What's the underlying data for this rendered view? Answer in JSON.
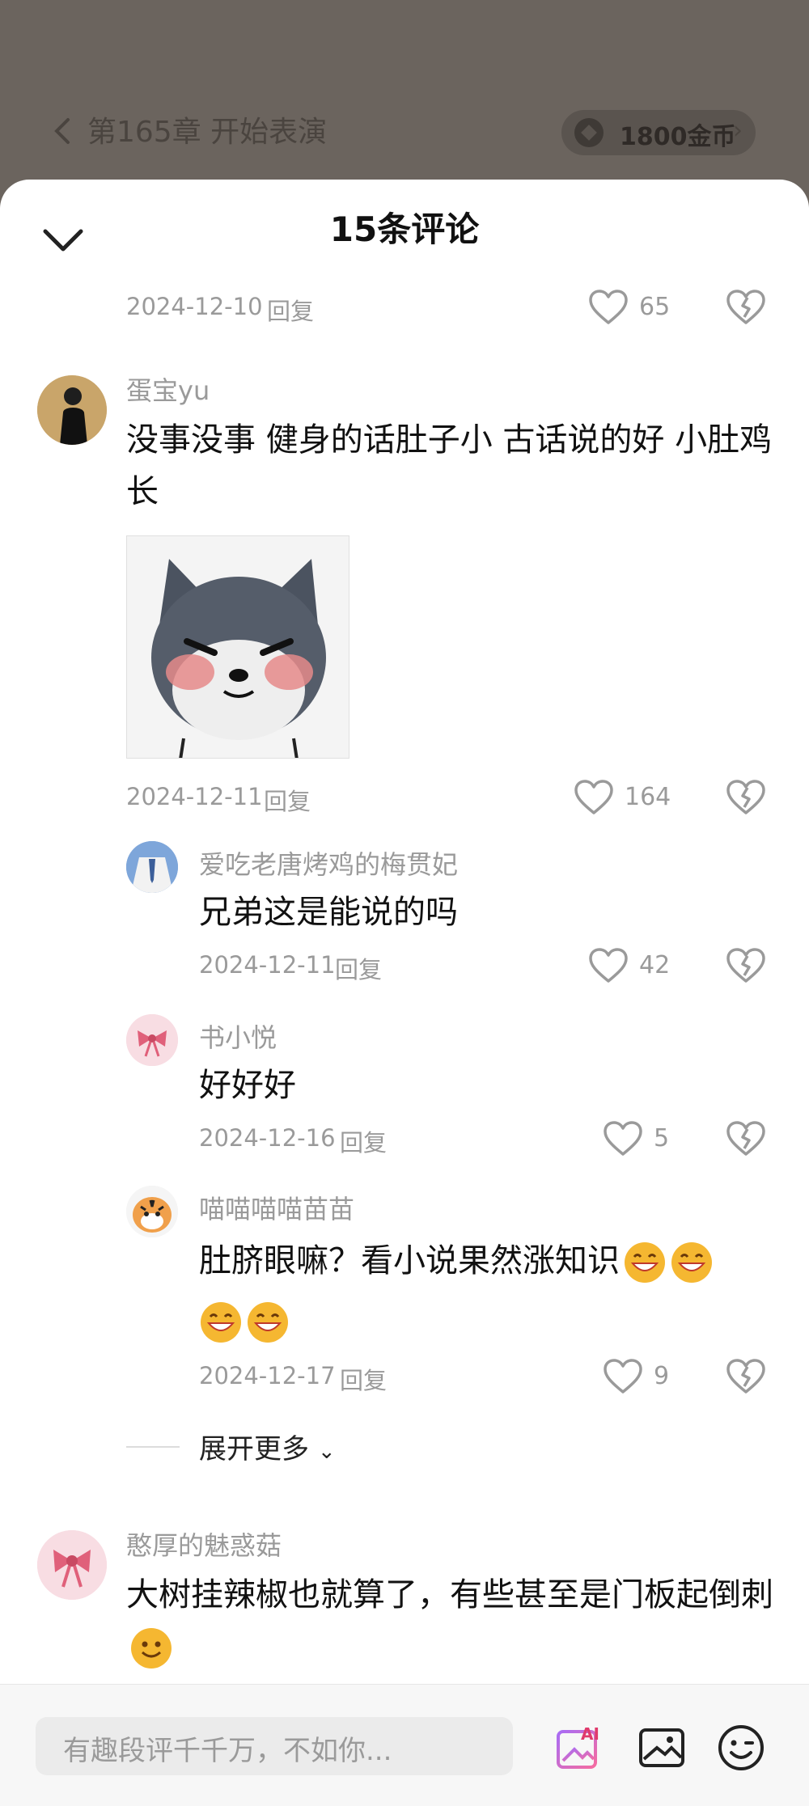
{
  "background": {
    "chapter_title": "第165章 开始表演",
    "coins_label": "1800金币"
  },
  "sheet": {
    "title": "15条评论",
    "top_item": {
      "date": "2024-12-10",
      "reply": "回复",
      "likes": "65"
    },
    "comments": [
      {
        "user": "蛋宝yu",
        "text": "没事没事 健身的话肚子小 古话说的好 小肚鸡长",
        "date": "2024-12-11",
        "reply": "回复",
        "likes": "164",
        "replies": [
          {
            "user": "爱吃老唐烤鸡的梅贯妃",
            "text": "兄弟这是能说的吗",
            "date": "2024-12-11",
            "reply": "回复",
            "likes": "42"
          },
          {
            "user": "书小悦",
            "text": "好好好",
            "date": "2024-12-16",
            "reply": "回复",
            "likes": "5"
          },
          {
            "user": "喵喵喵喵苗苗",
            "text": "肚脐眼嘛？看小说果然涨知识",
            "date": "2024-12-17",
            "reply": "回复",
            "likes": "9"
          }
        ],
        "expand_label": "展开更多"
      },
      {
        "user": "憨厚的魅惑菇",
        "text": "大树挂辣椒也就算了，有些甚至是门板起倒刺"
      }
    ]
  },
  "bottom_bar": {
    "input_placeholder": "有趣段评千千万，不如你...",
    "ai_label": "AI"
  },
  "icons": [
    "chevron-left-icon",
    "coin-icon",
    "chevron-right-icon",
    "chevron-down-icon",
    "heart-icon",
    "broken-heart-icon",
    "grin-emoji-icon",
    "smile-emoji-icon",
    "ai-icon",
    "image-icon",
    "emoji-icon"
  ],
  "colors": {
    "overlay": "#6b645e",
    "text": "#111111",
    "muted": "#9a9a9a",
    "emoji": "#f5a623"
  }
}
